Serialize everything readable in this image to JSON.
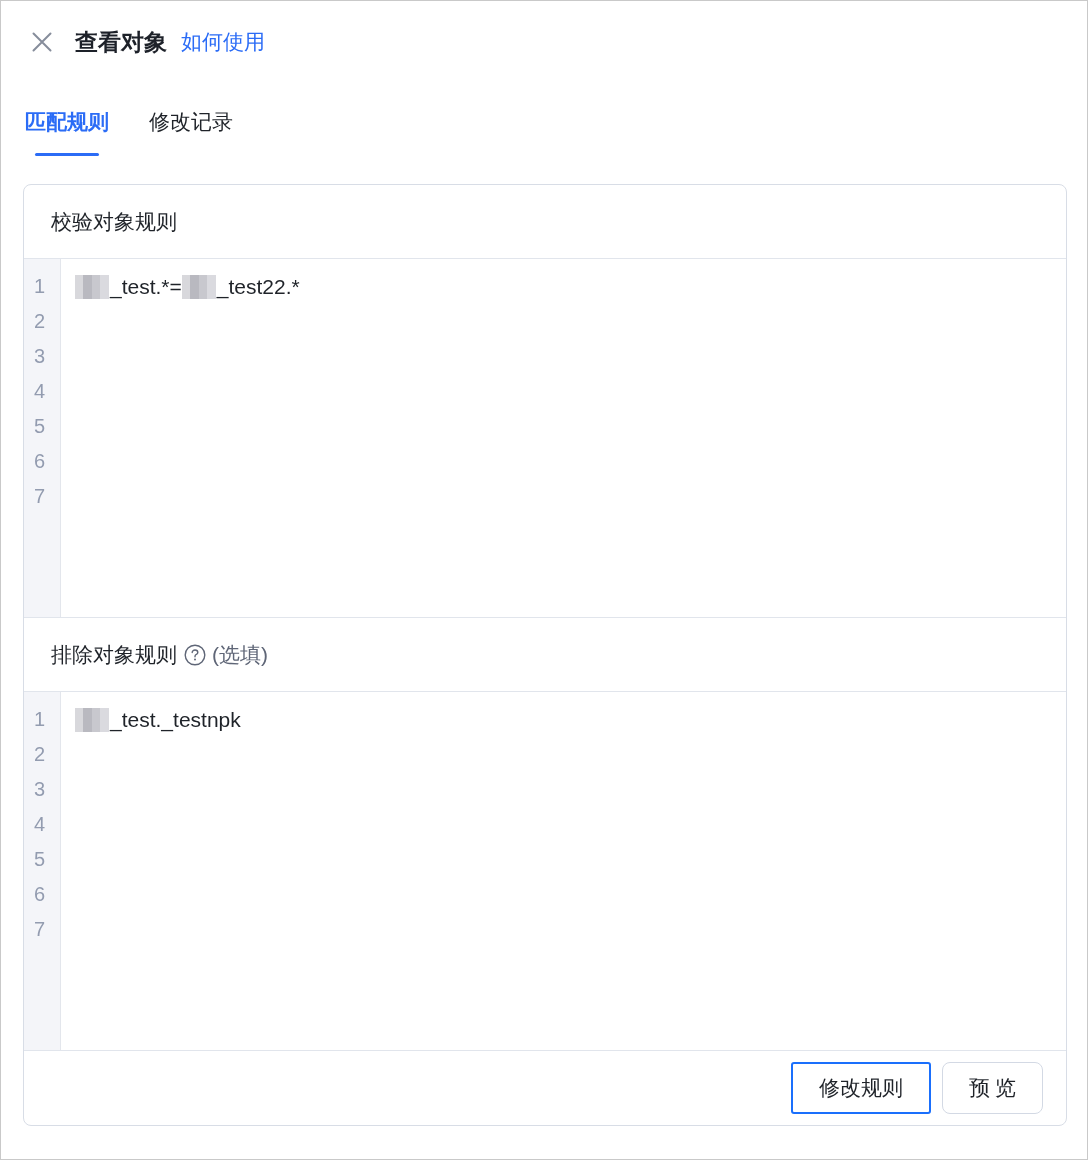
{
  "header": {
    "title": "查看对象",
    "link": "如何使用"
  },
  "tabs": [
    {
      "label": "匹配规则",
      "selected": true
    },
    {
      "label": "修改记录",
      "selected": false
    }
  ],
  "sections": [
    {
      "title": "校验对象规则",
      "help_icon": false,
      "editor": {
        "line_numbers": [
          "1",
          "2",
          "3",
          "4",
          "5",
          "6",
          "7"
        ],
        "lines": [
          [
            {
              "kind": "redacted"
            },
            {
              "kind": "text",
              "text": "_test.*="
            },
            {
              "kind": "redacted"
            },
            {
              "kind": "text",
              "text": "_test22.*"
            }
          ]
        ]
      }
    },
    {
      "title": "排除对象规则",
      "help_icon": true,
      "note": "(选填)",
      "editor": {
        "line_numbers": [
          "1",
          "2",
          "3",
          "4",
          "5",
          "6",
          "7"
        ],
        "lines": [
          [
            {
              "kind": "redacted"
            },
            {
              "kind": "text",
              "text": "_test._testnpk"
            }
          ]
        ]
      }
    }
  ],
  "buttons": [
    {
      "label": "修改规则",
      "focused": true
    },
    {
      "label": "预 览",
      "focused": false
    }
  ]
}
